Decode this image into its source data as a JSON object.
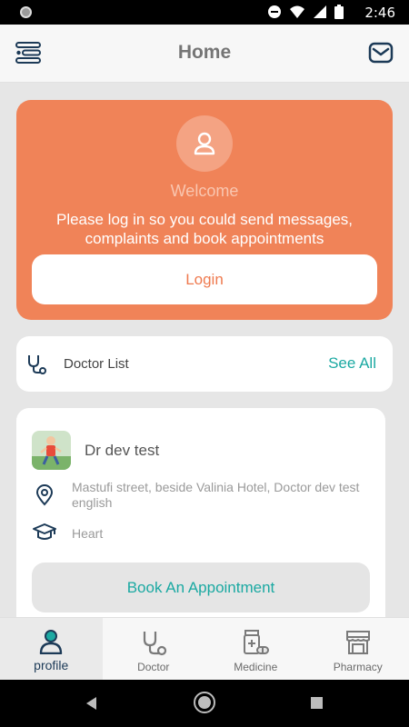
{
  "status_bar": {
    "time": "2:46"
  },
  "app_bar": {
    "title": "Home"
  },
  "welcome": {
    "title": "Welcome",
    "message": "Please log in so you could send messages, complaints and book appointments",
    "login_label": "Login"
  },
  "doctor_list": {
    "label": "Doctor List",
    "see_all": "See All"
  },
  "doctor": {
    "name": "Dr dev test",
    "address": "Mastufi street, beside Valinia Hotel, Doctor dev test english",
    "speciality": "Heart",
    "book_label": "Book An Appointment"
  },
  "bottom_nav": {
    "items": [
      {
        "label": "profile",
        "icon": "profile-icon",
        "active": true
      },
      {
        "label": "Doctor",
        "icon": "stethoscope-icon",
        "active": false
      },
      {
        "label": "Medicine",
        "icon": "medicine-icon",
        "active": false
      },
      {
        "label": "Pharmacy",
        "icon": "pharmacy-icon",
        "active": false
      }
    ]
  },
  "colors": {
    "accent": "#f08358",
    "teal": "#1ba9a2",
    "navy": "#1c3a57"
  }
}
